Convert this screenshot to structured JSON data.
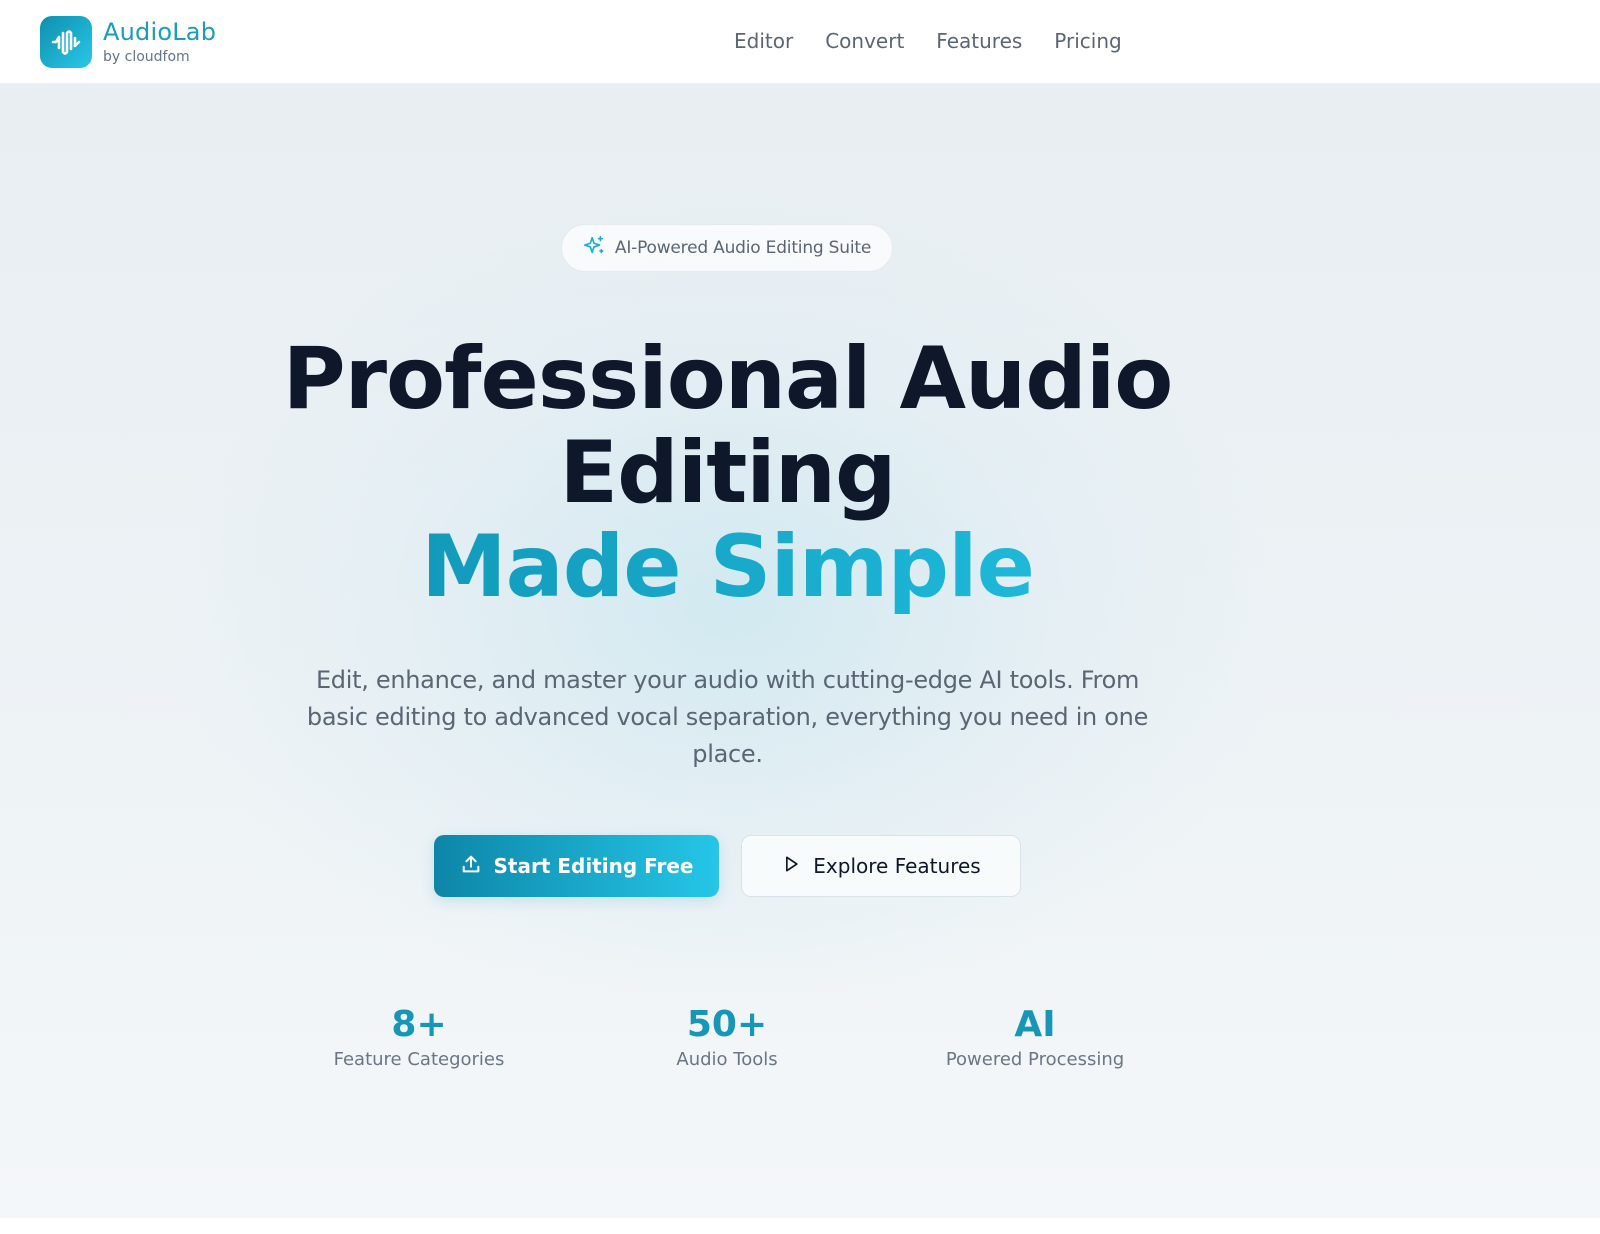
{
  "brand": {
    "name": "AudioLab",
    "tagline": "by cloudfom",
    "logo_icon": "waveform-icon",
    "accent_color": "#1a9dbd"
  },
  "nav": {
    "items": [
      {
        "label": "Editor"
      },
      {
        "label": "Convert"
      },
      {
        "label": "Features"
      },
      {
        "label": "Pricing"
      }
    ]
  },
  "hero": {
    "badge": {
      "icon": "sparkles-icon",
      "text": "AI-Powered Audio Editing Suite"
    },
    "headline_line1": "Professional Audio",
    "headline_line2": "Editing",
    "headline_accent": "Made Simple",
    "subtitle": "Edit, enhance, and master your audio with cutting-edge AI tools. From basic editing to advanced vocal separation, everything you need in one place.",
    "primary_button": {
      "label": "Start Editing Free",
      "icon": "upload-icon"
    },
    "secondary_button": {
      "label": "Explore Features",
      "icon": "play-icon"
    }
  },
  "stats": [
    {
      "value": "8+",
      "label": "Feature Categories"
    },
    {
      "value": "50+",
      "label": "Audio Tools"
    },
    {
      "value": "AI",
      "label": "Powered Processing"
    }
  ],
  "colors": {
    "primary_gradient_start": "#0d86a8",
    "primary_gradient_end": "#25c6e7",
    "heading": "#0f172a",
    "body_text": "#5b6675"
  }
}
